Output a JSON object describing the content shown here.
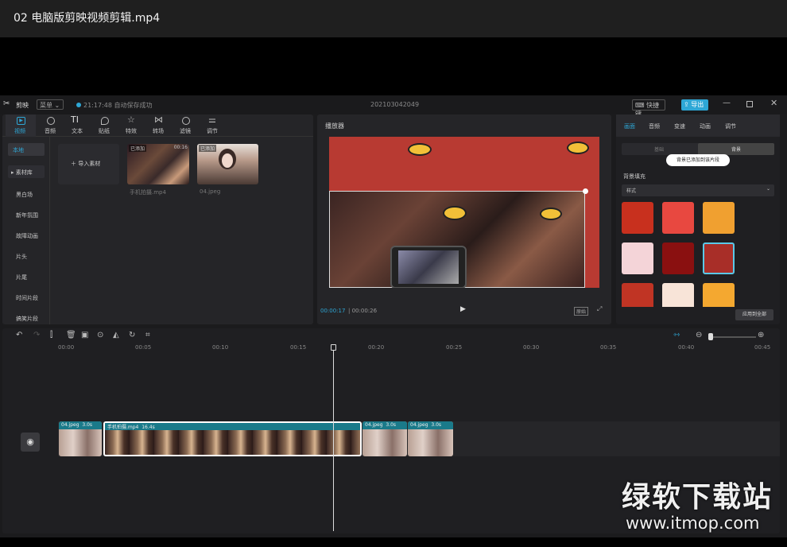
{
  "page": {
    "title": "02  电脑版剪映视频剪辑.mp4"
  },
  "app": {
    "name": "剪映",
    "menu_label": "菜单",
    "autosave": "21:17:48 自动保存成功",
    "project_name": "202103042049",
    "shortcut_label": "快捷键",
    "export_label": "导出"
  },
  "toolbar": {
    "tabs": [
      {
        "label": "视频",
        "icon": "video-icon"
      },
      {
        "label": "音频",
        "icon": "audio-icon"
      },
      {
        "label": "文本",
        "icon": "text-icon"
      },
      {
        "label": "贴纸",
        "icon": "sticker-icon"
      },
      {
        "label": "特效",
        "icon": "effects-icon"
      },
      {
        "label": "转场",
        "icon": "transition-icon"
      },
      {
        "label": "滤镜",
        "icon": "filter-icon"
      },
      {
        "label": "调节",
        "icon": "adjust-icon"
      }
    ]
  },
  "sidebar": {
    "items": [
      "本地",
      "素材库",
      "黑白场",
      "新年氛围",
      "故障动画",
      "片头",
      "片尾",
      "时间片段",
      "搞笑片段"
    ]
  },
  "media": {
    "import_label": "导入素材",
    "items": [
      {
        "name": "手机拍摄.mp4",
        "badge": "已添加",
        "duration": "00:16"
      },
      {
        "name": "04.jpeg",
        "badge": "已添加"
      }
    ]
  },
  "player": {
    "title": "播放器",
    "current_time": "00:00:17",
    "total_time": "00:00:26",
    "ratio_label": "原始"
  },
  "inspector": {
    "tabs": [
      "画面",
      "音频",
      "变速",
      "动画",
      "调节"
    ],
    "subtabs": [
      "基础",
      "背景"
    ],
    "toast": "背景已添加到该片段",
    "section_label": "背景填充",
    "select_value": "样式",
    "apply_all_label": "应用到全部"
  },
  "timeline": {
    "ruler": [
      "00:00",
      "00:05",
      "00:10",
      "00:15",
      "00:20",
      "00:25",
      "00:30",
      "00:35",
      "00:40",
      "00:45"
    ],
    "clips": [
      {
        "name": "04.jpeg",
        "duration": "3.0s"
      },
      {
        "name": "手机拍摄.mp4",
        "duration": "16.4s"
      },
      {
        "name": "04.jpeg",
        "duration": "3.0s"
      },
      {
        "name": "04.jpeg",
        "duration": "3.0s"
      }
    ]
  },
  "watermark": {
    "line1": "绿软下载站",
    "line2": "www.itmop.com"
  },
  "colors": {
    "accent": "#2ea7d6",
    "clip_header": "#1a7a8a",
    "panel": "#252528"
  }
}
